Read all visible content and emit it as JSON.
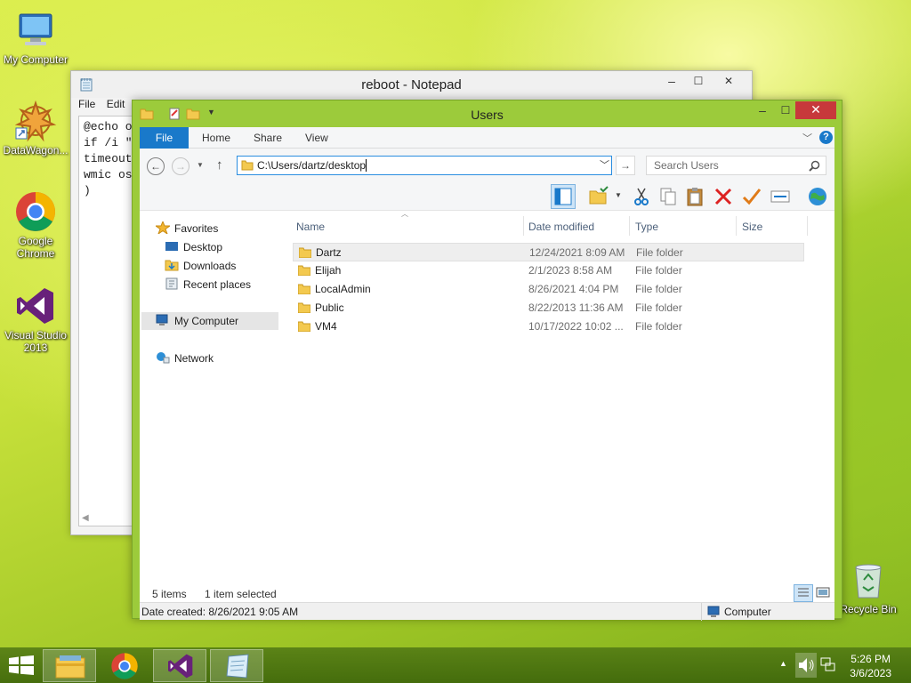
{
  "desktop": {
    "icons": [
      {
        "label": "My Computer"
      },
      {
        "label": "DataWagon..."
      },
      {
        "label": "Google Chrome"
      },
      {
        "label": "Visual Studio 2013"
      },
      {
        "label": "Recycle Bin"
      }
    ]
  },
  "notepad": {
    "title": "reboot - Notepad",
    "menu": [
      "File",
      "Edit"
    ],
    "lines": [
      "@echo o",
      "if /i \"",
      "timeout",
      "wmic os",
      ")"
    ],
    "buttons": {
      "minimize": "–",
      "maximize": "☐",
      "close": "✕"
    }
  },
  "explorer": {
    "title": "Users",
    "buttons": {
      "minimize": "–",
      "maximize": "☐",
      "close": "✕"
    },
    "ribbon_tabs": [
      "File",
      "Home",
      "Share",
      "View"
    ],
    "address": "C:\\Users/dartz/desktop",
    "search_placeholder": "Search Users",
    "nav": {
      "favorites": "Favorites",
      "desktop": "Desktop",
      "downloads": "Downloads",
      "recent": "Recent places",
      "computer": "My Computer",
      "network": "Network"
    },
    "columns": {
      "name": "Name",
      "date": "Date modified",
      "type": "Type",
      "size": "Size"
    },
    "rows": [
      {
        "name": "Dartz",
        "date": "12/24/2021 8:09 AM",
        "type": "File folder"
      },
      {
        "name": "Elijah",
        "date": "2/1/2023 8:58 AM",
        "type": "File folder"
      },
      {
        "name": "LocalAdmin",
        "date": "8/26/2021 4:04 PM",
        "type": "File folder"
      },
      {
        "name": "Public",
        "date": "8/22/2013 11:36 AM",
        "type": "File folder"
      },
      {
        "name": "VM4",
        "date": "10/17/2022 10:02 ...",
        "type": "File folder"
      }
    ],
    "status": {
      "items": "5 items",
      "selected": "1 item selected"
    },
    "details": {
      "date_created": "Date created: 8/26/2021 9:05 AM",
      "location": "Computer"
    }
  },
  "taskbar": {
    "time": "5:26 PM",
    "date": "3/6/2023"
  },
  "colors": {
    "accent": "#1979ca",
    "window_frame": "#9ccb3b",
    "close": "#c7383b"
  }
}
